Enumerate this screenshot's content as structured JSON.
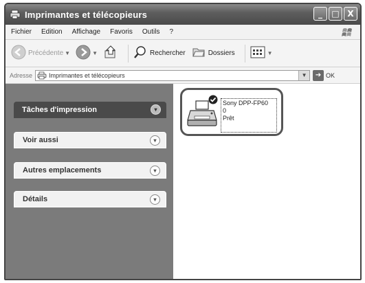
{
  "window": {
    "title": "Imprimantes et télécopieurs",
    "title_icon": "printer-folder-icon",
    "buttons": [
      "_",
      "□",
      "X"
    ]
  },
  "menubar": {
    "items": [
      "Fichier",
      "Edition",
      "Affichage",
      "Favoris",
      "Outils",
      "?"
    ]
  },
  "toolbar": {
    "back_label": "Précédente",
    "search_label": "Rechercher",
    "folders_label": "Dossiers"
  },
  "address": {
    "label": "Adresse",
    "value": "Imprimantes et télécopieurs",
    "go_label": "OK"
  },
  "tasks": {
    "items": [
      {
        "label": "Tâches d'impression",
        "selected": true
      },
      {
        "label": "Voir aussi",
        "selected": false
      },
      {
        "label": "Autres emplacements",
        "selected": false
      },
      {
        "label": "Détails",
        "selected": false
      }
    ]
  },
  "printer": {
    "name": "Sony DPP-FP60",
    "count": "0",
    "status": "Prêt",
    "icon": "printer-icon",
    "default_badge": "check-badge-icon"
  }
}
